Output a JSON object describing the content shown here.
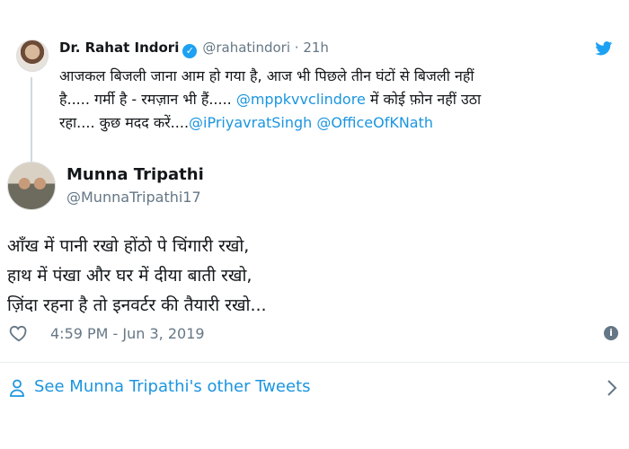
{
  "quoted_tweet": {
    "name": "Dr. Rahat Indori",
    "handle": "@rahatindori",
    "separator": "·",
    "time": "21h",
    "line1": "आजकल बिजली जाना आम हो गया है, आज भी पिछले तीन घंटों से बिजली नहीं",
    "line2a": "है..... गर्मी है - रमज़ान भी हैं..... ",
    "mention1": "@mppkvvclindore",
    "line2b": " में कोई फ़ोन नहीं उठा",
    "line3a": "रहा.... कुछ मदद करें....",
    "mention2": "@iPriyavratSingh",
    "mention3": "@OfficeOfKNath"
  },
  "main_tweet": {
    "name": "Munna Tripathi",
    "handle": "@MunnaTripathi17",
    "poem_lines": [
      "आँख में पानी रखो होंठो पे चिंगारी रखो,",
      "हाथ में पंखा और घर में दीया बाती रखो,",
      "ज़िंदा रहना है तो इनवर्टर की तैयारी रखो..."
    ],
    "timestamp": "4:59 PM - Jun 3, 2019"
  },
  "footer": {
    "other_tweets_label": "See Munna Tripathi's other Tweets"
  },
  "icons": {
    "verified": "verified-badge-icon",
    "bird": "twitter-bird-icon",
    "heart": "heart-icon",
    "info": "info-icon",
    "person": "person-icon",
    "chevron": "chevron-right-icon"
  },
  "colors": {
    "link": "#1b95e0",
    "muted": "#657786",
    "verified": "#1da1f2"
  }
}
